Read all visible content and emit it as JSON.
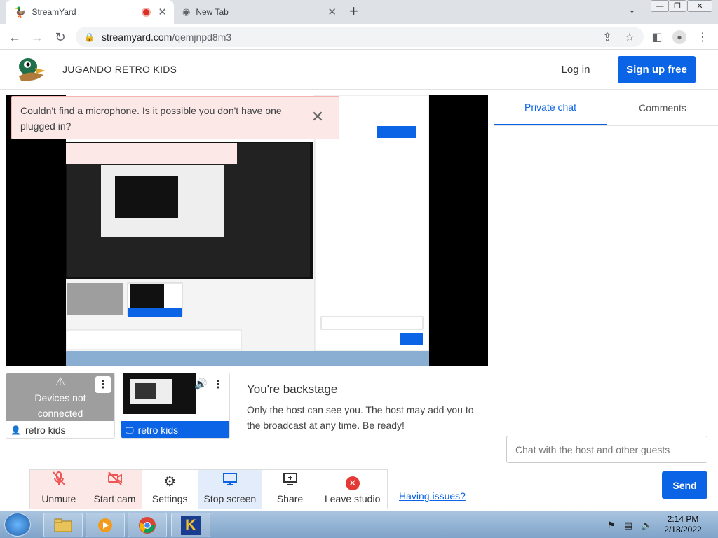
{
  "browser": {
    "tabs": [
      {
        "title": "StreamYard",
        "active": true
      },
      {
        "title": "New Tab",
        "active": false
      }
    ],
    "url_host": "streamyard.com",
    "url_path": "/qemjnpd8m3"
  },
  "header": {
    "brand": "JUGANDO RETRO KIDS",
    "login": "Log in",
    "signup": "Sign up free"
  },
  "alert": {
    "message": "Couldn't find a microphone. Is it possible you don't have one plugged in?",
    "close": "✕"
  },
  "tiles": [
    {
      "status": "Devices not connected",
      "name": "retro kids"
    },
    {
      "name": "retro kids"
    }
  ],
  "backstage": {
    "title": "You're backstage",
    "text": "Only the host can see you. The host may add you to the broadcast at any time. Be ready!"
  },
  "controls": [
    {
      "label": "Unmute",
      "icon": "mic-off-icon"
    },
    {
      "label": "Start cam",
      "icon": "camera-off-icon"
    },
    {
      "label": "Settings",
      "icon": "gear-icon"
    },
    {
      "label": "Stop screen",
      "icon": "monitor-icon"
    },
    {
      "label": "Share",
      "icon": "share-icon"
    },
    {
      "label": "Leave studio",
      "icon": "leave-icon"
    }
  ],
  "help_link": "Having issues?",
  "chat": {
    "tabs": [
      "Private chat",
      "Comments"
    ],
    "placeholder": "Chat with the host and other guests",
    "send": "Send"
  },
  "taskbar": {
    "time": "2:14 PM",
    "date": "2/18/2022"
  },
  "colors": {
    "accent": "#0b63e5",
    "alert_bg": "#fce8e6"
  }
}
